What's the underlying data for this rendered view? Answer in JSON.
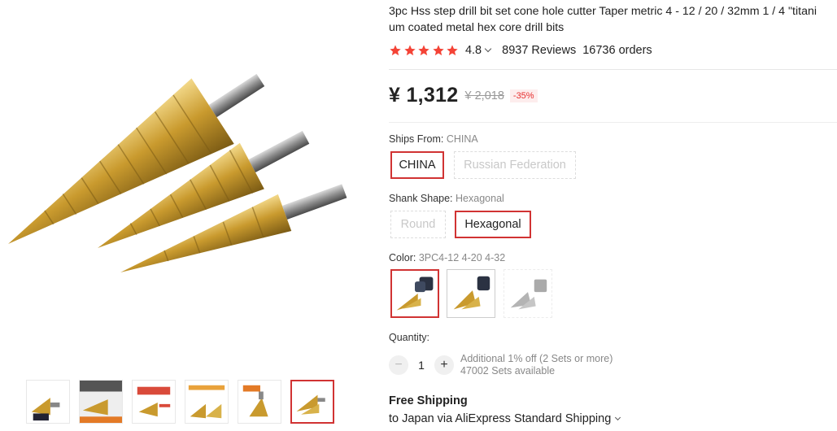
{
  "product": {
    "title_line1": "3pc Hss step drill bit set cone hole cutter Taper metric 4 - 12 / 20 / 32mm 1 / 4 \"titani",
    "title_line2": "um coated metal hex core drill bits",
    "rating": "4.8",
    "reviews": "8937 Reviews",
    "orders": "16736 orders",
    "stars": 5,
    "price": "¥ 1,312",
    "original_price": "¥ 2,018",
    "discount": "-35%"
  },
  "ships_from": {
    "label": "Ships From:",
    "value": "CHINA",
    "options": [
      "CHINA",
      "Russian Federation"
    ]
  },
  "shank_shape": {
    "label": "Shank Shape:",
    "value": "Hexagonal",
    "options": [
      "Round",
      "Hexagonal"
    ]
  },
  "color": {
    "label": "Color:",
    "value": "3PC4-12 4-20 4-32"
  },
  "quantity": {
    "label": "Quantity:",
    "value": "1",
    "minus": "−",
    "plus": "+",
    "note_line1": "Additional 1% off (2 Sets or more)",
    "note_line2": "47002 Sets available"
  },
  "shipping": {
    "title": "Free Shipping",
    "desc": "to Japan via AliExpress Standard Shipping"
  },
  "colors": {
    "accent": "#d13333",
    "star": "#f44336",
    "gold": "#c9a233"
  },
  "icons": [
    "star-icon",
    "chevron-down-icon"
  ]
}
